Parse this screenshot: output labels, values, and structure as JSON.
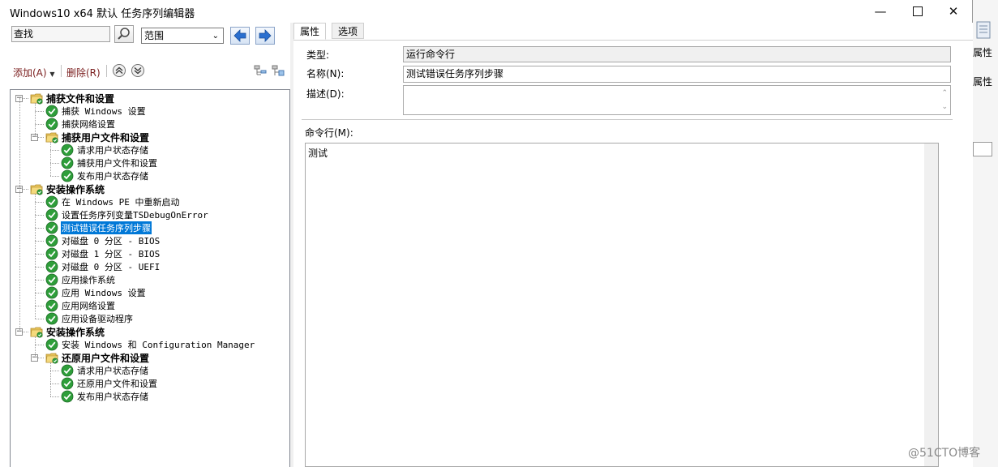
{
  "window": {
    "title": "Windows10 x64 默认 任务序列编辑器",
    "controls": [
      "minimize-icon",
      "maximize-icon",
      "close-icon"
    ]
  },
  "search": {
    "value": "查找",
    "scope": "范围"
  },
  "toolbar": {
    "add_label": "添加(A)",
    "delete_label": "删除(R)"
  },
  "tree": [
    {
      "label": "捕获文件和设置",
      "level": 0,
      "group": true,
      "expanded": true
    },
    {
      "label": "捕获 Windows 设置",
      "level": 1
    },
    {
      "label": "捕获网络设置",
      "level": 1
    },
    {
      "label": "捕获用户文件和设置",
      "level": 1,
      "group": true,
      "expanded": true
    },
    {
      "label": "请求用户状态存储",
      "level": 2
    },
    {
      "label": "捕获用户文件和设置",
      "level": 2
    },
    {
      "label": "发布用户状态存储",
      "level": 2
    },
    {
      "label": "安装操作系统",
      "level": 0,
      "group": true,
      "expanded": true
    },
    {
      "label": "在 Windows PE 中重新启动",
      "level": 1
    },
    {
      "label": "设置任务序列变量TSDebugOnError",
      "level": 1
    },
    {
      "label": "测试错误任务序列步骤",
      "level": 1,
      "selected": true
    },
    {
      "label": "对磁盘 0 分区 - BIOS",
      "level": 1
    },
    {
      "label": "对磁盘 1 分区 - BIOS",
      "level": 1
    },
    {
      "label": "对磁盘 0 分区 - UEFI",
      "level": 1
    },
    {
      "label": "应用操作系统",
      "level": 1
    },
    {
      "label": "应用 Windows 设置",
      "level": 1
    },
    {
      "label": "应用网络设置",
      "level": 1
    },
    {
      "label": "应用设备驱动程序",
      "level": 1
    },
    {
      "label": "安装操作系统",
      "level": 0,
      "group": true,
      "expanded": true
    },
    {
      "label": "安装 Windows 和 Configuration Manager",
      "level": 1
    },
    {
      "label": "还原用户文件和设置",
      "level": 1,
      "group": true,
      "expanded": true
    },
    {
      "label": "请求用户状态存储",
      "level": 2
    },
    {
      "label": "还原用户文件和设置",
      "level": 2
    },
    {
      "label": "发布用户状态存储",
      "level": 2
    }
  ],
  "tabs": [
    {
      "label": "属性",
      "active": true
    },
    {
      "label": "选项",
      "active": false
    }
  ],
  "properties": {
    "type_label": "类型:",
    "type_value": "运行命令行",
    "name_label": "名称(N):",
    "name_value": "测试错误任务序列步骤",
    "desc_label": "描述(D):",
    "desc_value": "",
    "cmd_label": "命令行(M):",
    "cmd_value": "测试"
  },
  "background_window": {
    "labels": [
      "属性",
      "属性"
    ]
  },
  "watermark": "@51CTO博客",
  "colors": {
    "selection": "#0078d7",
    "check_green": "#2e9e3a",
    "folder_yellow": "#e8c45a",
    "link_text": "#7a1d1d"
  }
}
